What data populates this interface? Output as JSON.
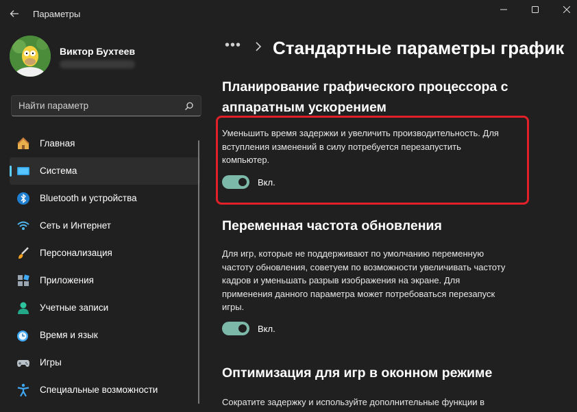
{
  "window": {
    "title": "Параметры",
    "minimize_icon": "minimize-icon",
    "maximize_icon": "maximize-icon",
    "close_icon": "close-icon"
  },
  "profile": {
    "name": "Виктор Бухтеев"
  },
  "search": {
    "placeholder": "Найти параметр"
  },
  "sidebar": {
    "items": [
      {
        "label": "Главная",
        "icon": "home-icon",
        "active": false
      },
      {
        "label": "Система",
        "icon": "system-display-icon",
        "active": true
      },
      {
        "label": "Bluetooth и устройства",
        "icon": "bluetooth-icon",
        "active": false
      },
      {
        "label": "Сеть и Интернет",
        "icon": "wifi-icon",
        "active": false
      },
      {
        "label": "Персонализация",
        "icon": "brush-icon",
        "active": false
      },
      {
        "label": "Приложения",
        "icon": "apps-icon",
        "active": false
      },
      {
        "label": "Учетные записи",
        "icon": "account-icon",
        "active": false
      },
      {
        "label": "Время и язык",
        "icon": "time-language-icon",
        "active": false
      },
      {
        "label": "Игры",
        "icon": "gamepad-icon",
        "active": false
      },
      {
        "label": "Специальные возможности",
        "icon": "accessibility-icon",
        "active": false
      }
    ]
  },
  "breadcrumb": {
    "overflow": "•••",
    "title": "Стандартные параметры график"
  },
  "sections": [
    {
      "title_line1": "Планирование графического процессора с",
      "title_line2": "аппаратным ускорением",
      "desc_lines": [
        "Уменьшить время задержки и увеличить производительность. Для",
        "вступления изменений в силу потребуется перезапустить",
        "компьютер."
      ],
      "toggle_state": "Вкл."
    },
    {
      "title_line1": "Переменная частота обновления",
      "desc_lines": [
        "Для игр, которые не поддерживают по умолчанию переменную",
        "частоту обновления, советуем по возможности увеличивать частоту",
        "кадров и уменьшать разрыв изображения на экране. Для",
        "применения данного параметра может потребоваться перезапуск",
        "игры."
      ],
      "toggle_state": "Вкл."
    },
    {
      "title_line1": "Оптимизация для игр в оконном режиме",
      "desc_lines": [
        "Сократите задержку и используйте дополнительные функции в"
      ]
    }
  ],
  "colors": {
    "background": "#202020",
    "accent": "#60cdff",
    "toggle_on": "#7cb9a8",
    "highlight": "#e2202a"
  }
}
